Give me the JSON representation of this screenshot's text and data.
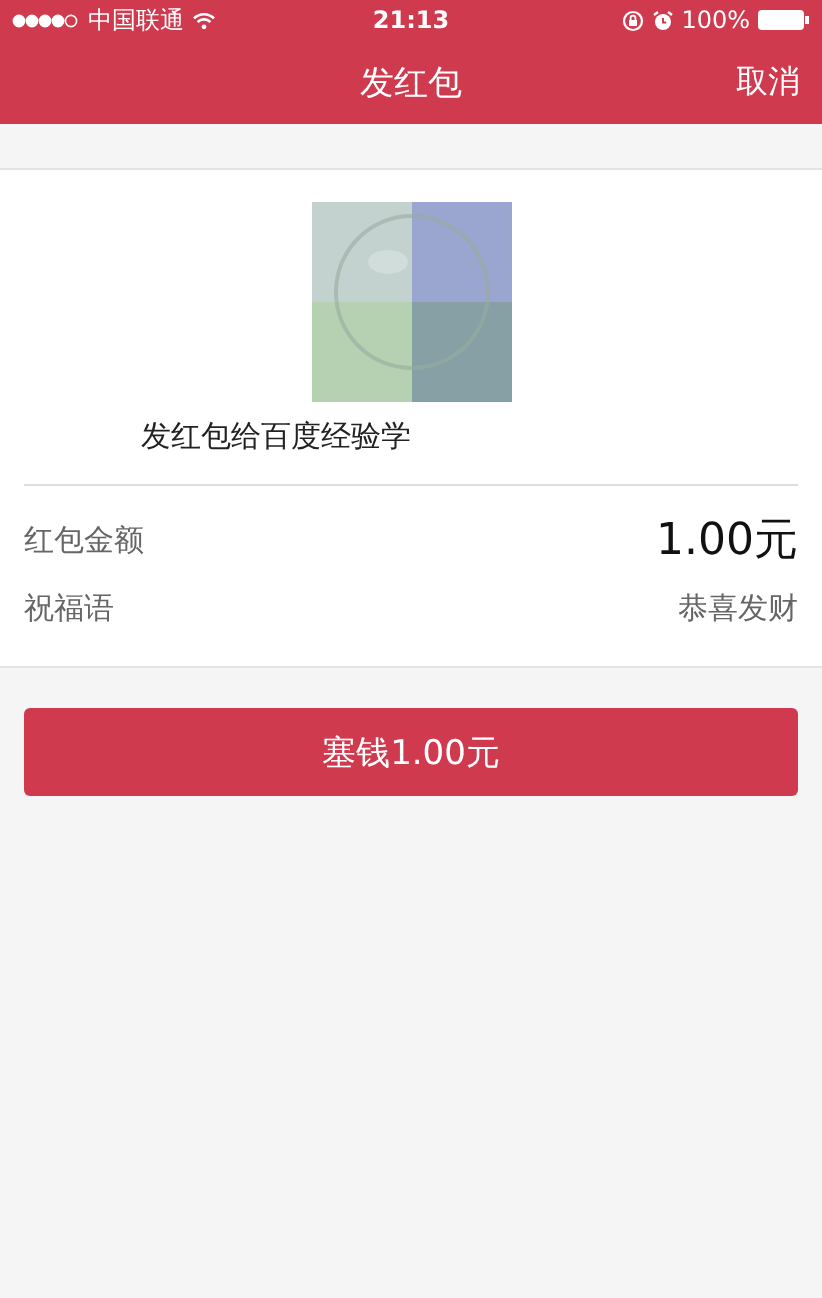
{
  "status_bar": {
    "carrier": "中国联通",
    "time": "21:13",
    "battery": "100%"
  },
  "nav": {
    "title": "发红包",
    "action": "取消"
  },
  "recipient": {
    "text": "发红包给百度经验学"
  },
  "fields": [
    {
      "label": "红包金额",
      "value": "1.00元",
      "kind": "amount"
    },
    {
      "label": "祝福语",
      "value": "恭喜发财",
      "kind": "text"
    }
  ],
  "submit": "塞钱1.00元"
}
